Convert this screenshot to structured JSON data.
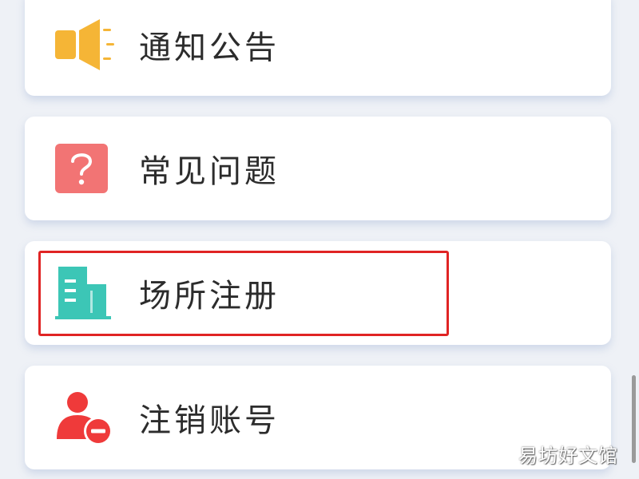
{
  "menu": {
    "items": [
      {
        "label": "通知公告",
        "icon": "megaphone-icon",
        "icon_color": "#f5b536"
      },
      {
        "label": "常见问题",
        "icon": "question-icon",
        "icon_color": "#f27474"
      },
      {
        "label": "场所注册",
        "icon": "building-icon",
        "icon_color": "#3cc6b6"
      },
      {
        "label": "注销账号",
        "icon": "remove-user-icon",
        "icon_color": "#ef3a3a"
      }
    ]
  },
  "highlight_color": "#e02424",
  "watermark": {
    "text": "易坊好文馆"
  }
}
